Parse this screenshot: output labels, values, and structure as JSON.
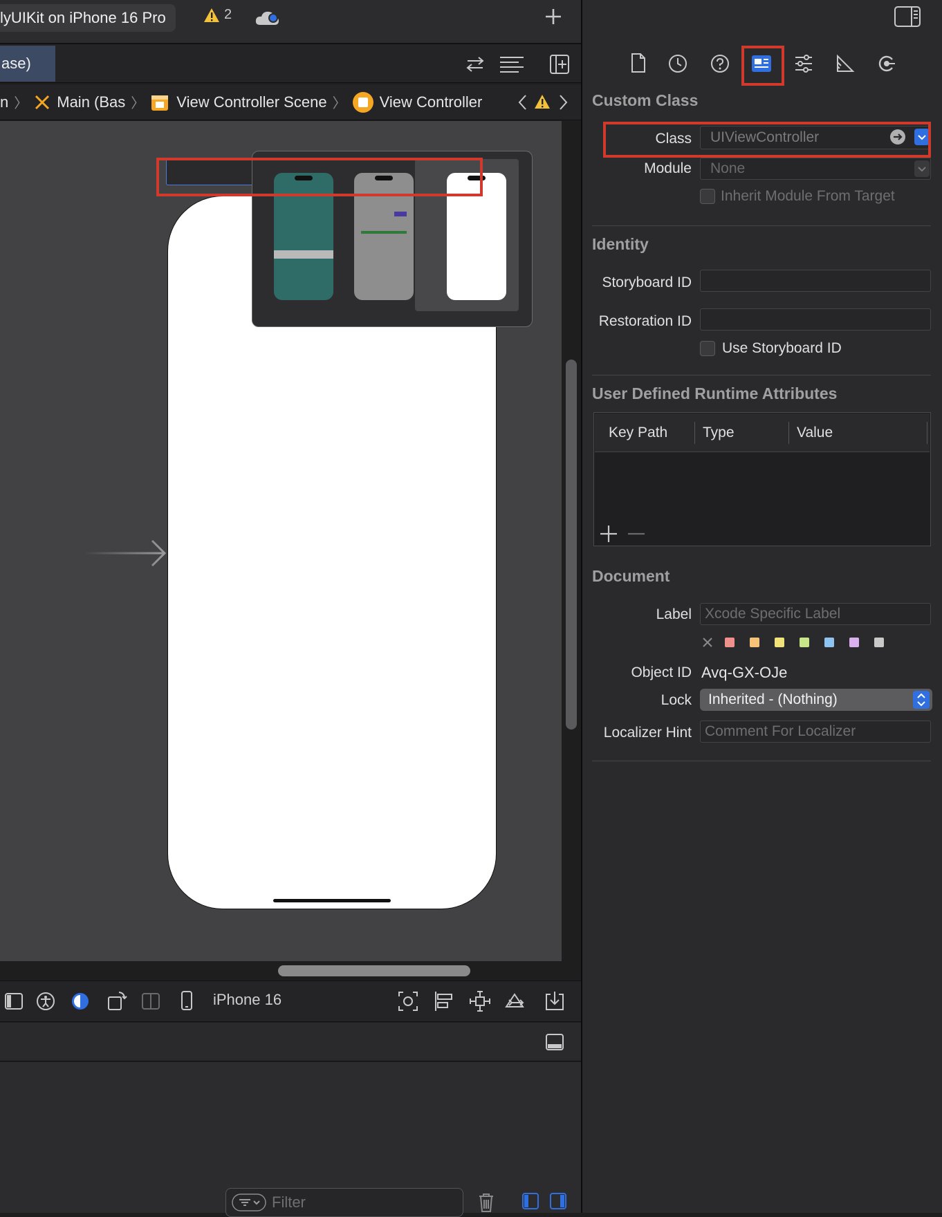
{
  "toolbar": {
    "scheme": "lyUIKit on iPhone 16 Pro",
    "warning_count": "2",
    "add_icon": "plus-icon",
    "inspector_toggle_icon": "sidebar-right-icon"
  },
  "editor": {
    "tab_label": "ase)",
    "breadcrumb": {
      "item0": "n",
      "item1": "Main (Bas",
      "item2": "View Controller Scene",
      "item3": "View Controller"
    },
    "device_name": "iPhone 16",
    "filter_placeholder": "Filter"
  },
  "inspector": {
    "tabs": [
      "file-icon",
      "history-icon",
      "help-icon",
      "identity-icon",
      "attributes-icon",
      "size-icon",
      "connections-icon"
    ],
    "selected_tab": "identity-icon",
    "custom_class": {
      "title": "Custom Class",
      "class_label": "Class",
      "class_placeholder": "UIViewController",
      "module_label": "Module",
      "module_placeholder": "None",
      "inherit_label": "Inherit Module From Target"
    },
    "identity": {
      "title": "Identity",
      "storyboard_id_label": "Storyboard ID",
      "restoration_id_label": "Restoration ID",
      "use_storyboard_label": "Use Storyboard ID"
    },
    "runtime": {
      "title": "User Defined Runtime Attributes",
      "columns": [
        "Key Path",
        "Type",
        "Value"
      ]
    },
    "document": {
      "title": "Document",
      "label_label": "Label",
      "label_placeholder": "Xcode Specific Label",
      "object_id_label": "Object ID",
      "object_id": "Avq-GX-OJe",
      "lock_label": "Lock",
      "lock_value": "Inherited - (Nothing)",
      "localizer_label": "Localizer Hint",
      "localizer_placeholder": "Comment For Localizer",
      "label_colors": [
        "#f0908c",
        "#f5c27a",
        "#f1e27a",
        "#c8e58a",
        "#8fc3f2",
        "#d8b1ee",
        "#c9c9c9"
      ]
    }
  },
  "accent_color": "#2f6fe0",
  "highlight_color": "#d03a2c"
}
